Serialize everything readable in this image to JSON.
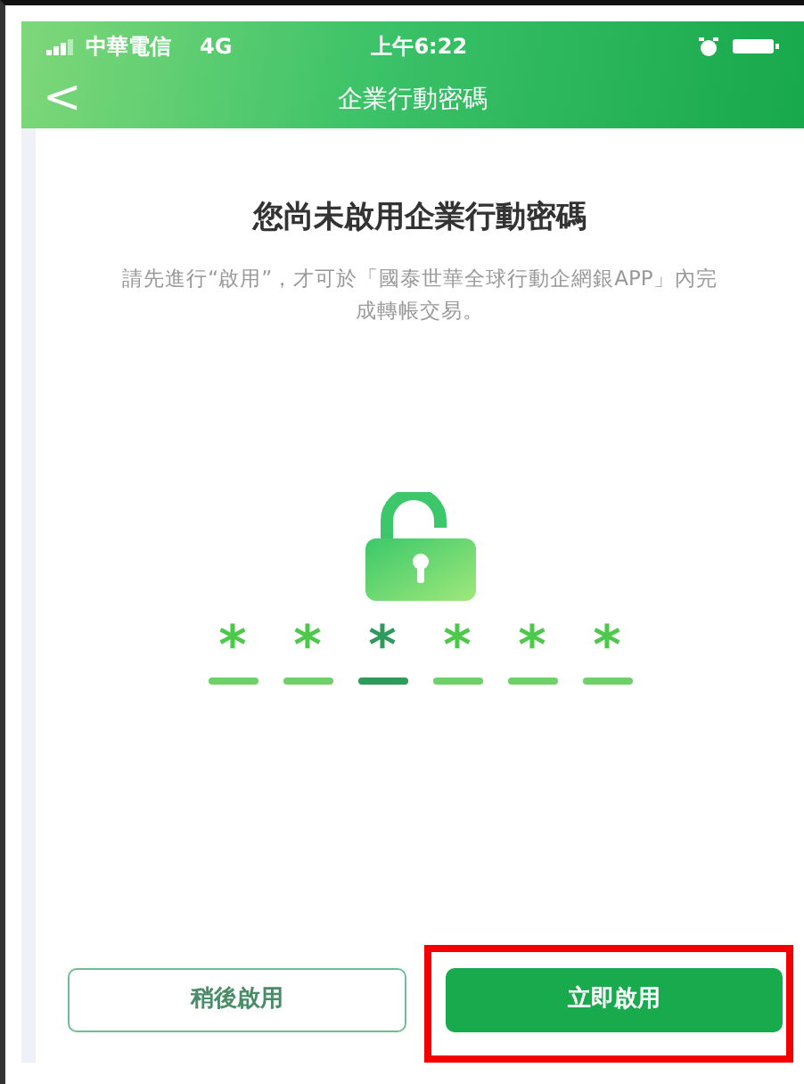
{
  "status_bar": {
    "carrier": "中華電信",
    "network": "4G",
    "time": "上午6:22"
  },
  "nav": {
    "back": "<",
    "title": "企業行動密碼"
  },
  "heading": "您尚未啟用企業行動密碼",
  "message": "請先進行“啟用”，才可於「國泰世華全球行動企網銀APP」內完成轉帳交易。",
  "pin": [
    {
      "char": "*",
      "active": false
    },
    {
      "char": "*",
      "active": false
    },
    {
      "char": "*",
      "active": true
    },
    {
      "char": "*",
      "active": false
    },
    {
      "char": "*",
      "active": false
    },
    {
      "char": "*",
      "active": false
    }
  ],
  "buttons": [
    {
      "label": "稍後啟用",
      "kind": "outline",
      "highlighted": false
    },
    {
      "label": "立即啟用",
      "kind": "primary",
      "highlighted": true
    }
  ]
}
